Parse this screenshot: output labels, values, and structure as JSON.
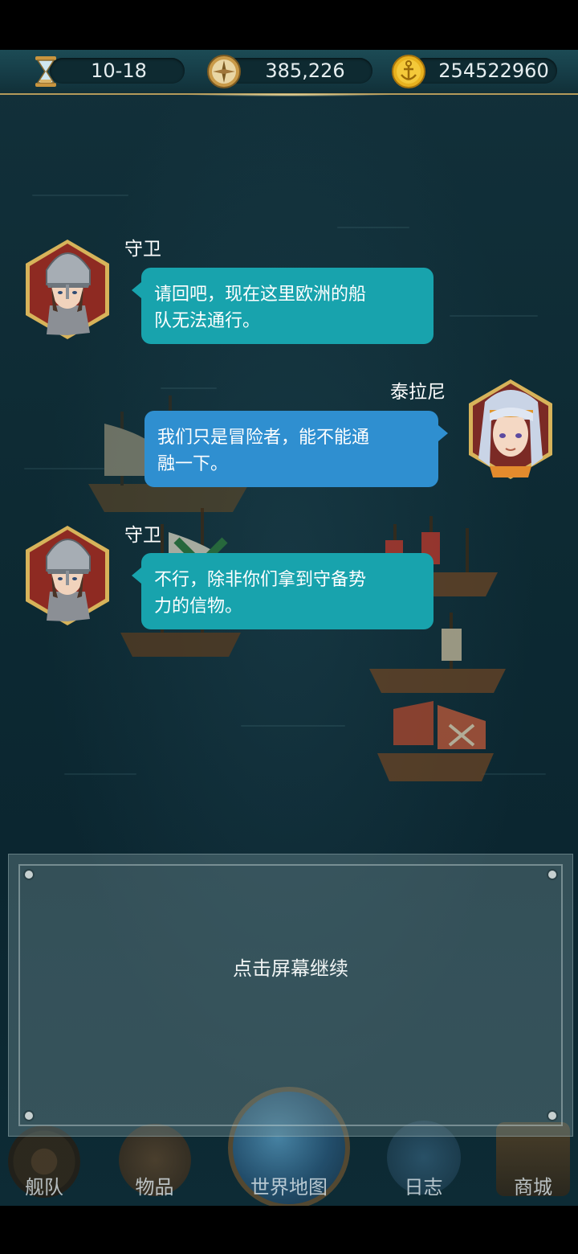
{
  "resources": {
    "date": "10-18",
    "compass_value": "385,226",
    "gold": "254522960",
    "icons": [
      "hourglass-icon",
      "compass-icon",
      "gold-coin-anchor-icon"
    ]
  },
  "dialog": [
    {
      "speaker": "守卫",
      "text": "请回吧，现在这里欧洲的船队无法通行。",
      "line1": "请回吧，现在这里欧洲的船",
      "line2": "队无法通行。",
      "side": "left",
      "bubble_color": "#18a3ad"
    },
    {
      "speaker": "泰拉尼",
      "text": "我们只是冒险者，能不能通融一下。",
      "line1": "我们只是冒险者，能不能通",
      "line2": "融一下。",
      "side": "right",
      "bubble_color": "#2f8fd0"
    },
    {
      "speaker": "守卫",
      "text": "不行，除非你们拿到守备势力的信物。",
      "line1": "不行，除非你们拿到守备势",
      "line2": "力的信物。",
      "side": "left",
      "bubble_color": "#18a3ad"
    }
  ],
  "panel": {
    "prompt": "点击屏幕继续"
  },
  "nav": [
    {
      "label": "舰队",
      "icon": "ship-wheel-icon"
    },
    {
      "label": "物品",
      "icon": "bag-icon"
    },
    {
      "label": "世界地图",
      "icon": "globe-icon"
    },
    {
      "label": "日志",
      "icon": "scroll-icon"
    },
    {
      "label": "商城",
      "icon": "treasure-chest-icon"
    }
  ]
}
